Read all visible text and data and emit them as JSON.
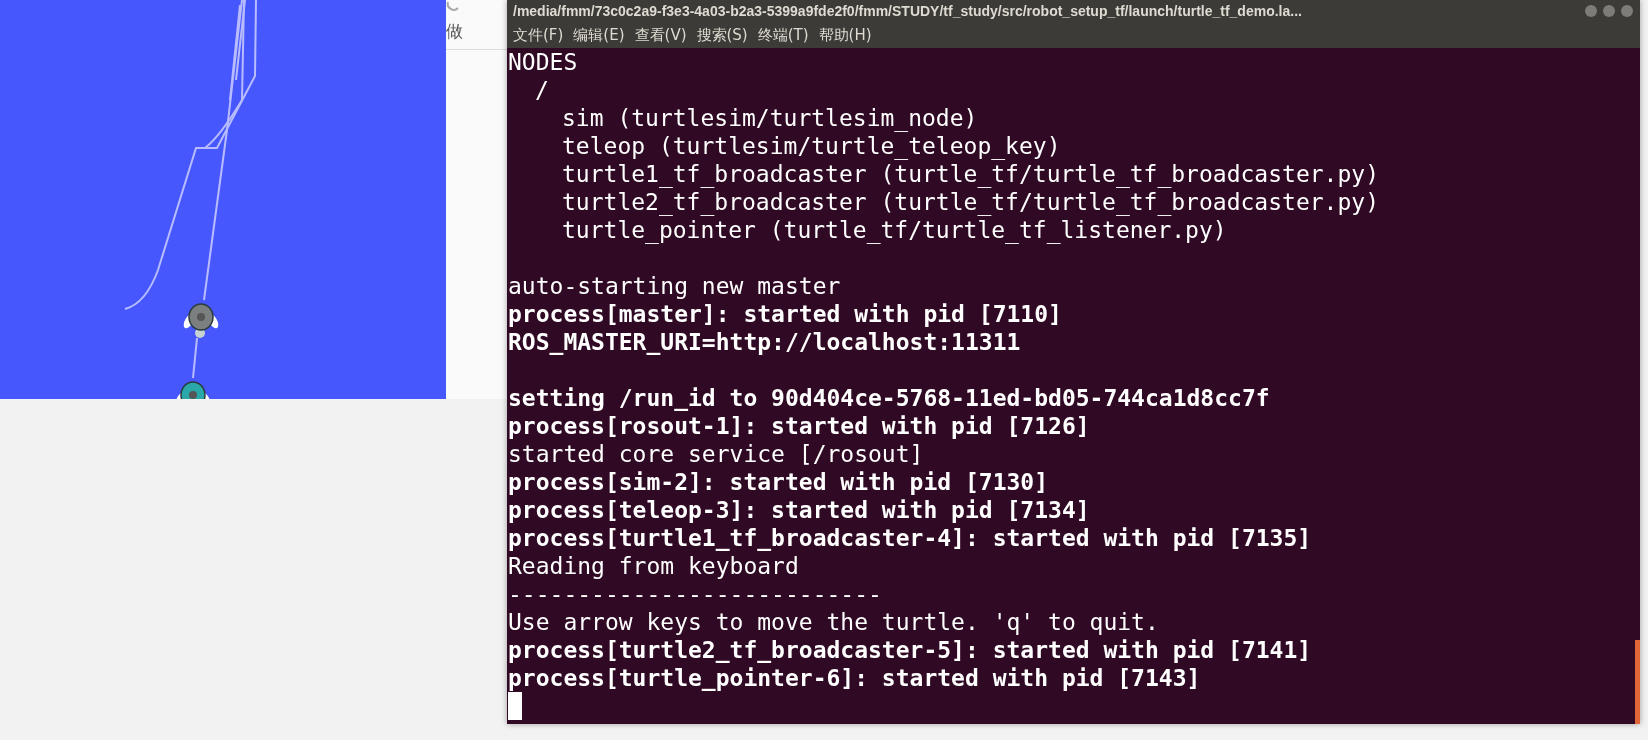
{
  "side_panel": {
    "label": "做"
  },
  "terminal": {
    "title": "/media/fmm/73c0c2a9-f3e3-4a03-b2a3-5399a9fde2f0/fmm/STUDY/tf_study/src/robot_setup_tf/launch/turtle_tf_demo.la...",
    "menu": [
      "文件(F)",
      "编辑(E)",
      "查看(V)",
      "搜索(S)",
      "终端(T)",
      "帮助(H)"
    ],
    "nodes": {
      "heading": "NODES",
      "children": [
        {
          "text": "/",
          "children": [
            {
              "text": "sim (turtlesim/turtlesim_node)"
            },
            {
              "text": "teleop (turtlesim/turtle_teleop_key)"
            },
            {
              "text": "turtle1_tf_broadcaster (turtle_tf/turtle_tf_broadcaster.py)"
            },
            {
              "text": "turtle2_tf_broadcaster (turtle_tf/turtle_tf_broadcaster.py)"
            },
            {
              "text": "turtle_pointer (turtle_tf/turtle_tf_listener.py)"
            }
          ]
        }
      ]
    },
    "lines": [
      {
        "kind": "blank"
      },
      {
        "kind": "text",
        "text": "auto-starting new master",
        "bold": false
      },
      {
        "kind": "text",
        "text": "process[master]: started with pid [7110]",
        "bold": true
      },
      {
        "kind": "text",
        "text": "ROS_MASTER_URI=http://localhost:11311",
        "bold": true
      },
      {
        "kind": "blank"
      },
      {
        "kind": "text",
        "text": "setting /run_id to 90d404ce-5768-11ed-bd05-744ca1d8cc7f",
        "bold": true
      },
      {
        "kind": "text",
        "text": "process[rosout-1]: started with pid [7126]",
        "bold": true
      },
      {
        "kind": "text",
        "text": "started core service [/rosout]",
        "bold": false
      },
      {
        "kind": "text",
        "text": "process[sim-2]: started with pid [7130]",
        "bold": true
      },
      {
        "kind": "text",
        "text": "process[teleop-3]: started with pid [7134]",
        "bold": true
      },
      {
        "kind": "text",
        "text": "process[turtle1_tf_broadcaster-4]: started with pid [7135]",
        "bold": true
      },
      {
        "kind": "text",
        "text": "Reading from keyboard",
        "bold": false
      },
      {
        "kind": "text",
        "text": "---------------------------",
        "bold": false
      },
      {
        "kind": "text",
        "text": "Use arrow keys to move the turtle. 'q' to quit.",
        "bold": false
      },
      {
        "kind": "text",
        "text": "process[turtle2_tf_broadcaster-5]: started with pid [7141]",
        "bold": true
      },
      {
        "kind": "text",
        "text": "process[turtle_pointer-6]: started with pid [7143]",
        "bold": true
      },
      {
        "kind": "cursor"
      }
    ]
  }
}
